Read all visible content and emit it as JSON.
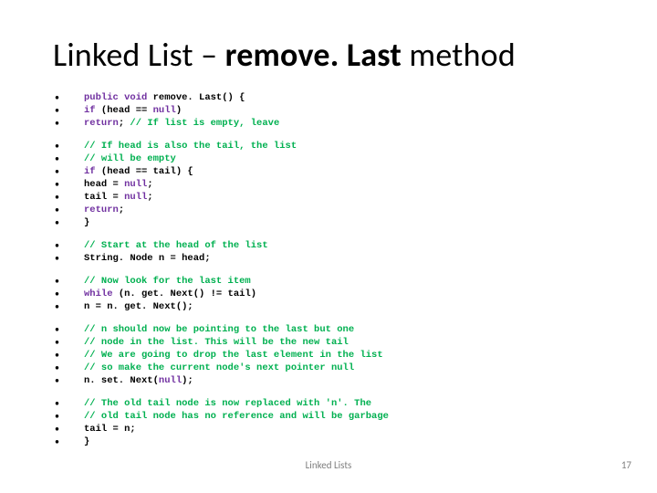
{
  "title": {
    "prefix": "Linked List – ",
    "bold": "remove. Last",
    "suffix": " method"
  },
  "blocks": [
    [
      {
        "spans": [
          {
            "t": "public void",
            "c": "kw"
          },
          {
            "t": " remove. Last() {",
            "c": "tx"
          }
        ]
      },
      {
        "spans": [
          {
            "t": "if",
            "c": "kw"
          },
          {
            "t": " (head == ",
            "c": "tx"
          },
          {
            "t": "null",
            "c": "kw"
          },
          {
            "t": ")",
            "c": "tx"
          }
        ]
      },
      {
        "spans": [
          {
            "t": "return",
            "c": "kw"
          },
          {
            "t": "; ",
            "c": "tx"
          },
          {
            "t": "// If list is empty, leave",
            "c": "cm"
          }
        ]
      }
    ],
    [
      {
        "spans": [
          {
            "t": "// If head is also the tail, the list",
            "c": "cm"
          }
        ]
      },
      {
        "spans": [
          {
            "t": "// will be empty",
            "c": "cm"
          }
        ]
      },
      {
        "spans": [
          {
            "t": "if",
            "c": "kw"
          },
          {
            "t": " (head == tail) {",
            "c": "tx"
          }
        ]
      },
      {
        "spans": [
          {
            "t": "head = ",
            "c": "tx"
          },
          {
            "t": "null",
            "c": "kw"
          },
          {
            "t": ";",
            "c": "tx"
          }
        ]
      },
      {
        "spans": [
          {
            "t": "tail = ",
            "c": "tx"
          },
          {
            "t": "null",
            "c": "kw"
          },
          {
            "t": ";",
            "c": "tx"
          }
        ]
      },
      {
        "spans": [
          {
            "t": "return",
            "c": "kw"
          },
          {
            "t": ";",
            "c": "tx"
          }
        ]
      },
      {
        "spans": [
          {
            "t": "}",
            "c": "tx"
          }
        ]
      }
    ],
    [
      {
        "spans": [
          {
            "t": "// Start at the head of the list",
            "c": "cm"
          }
        ]
      },
      {
        "spans": [
          {
            "t": "String. Node n = head;",
            "c": "tx"
          }
        ]
      }
    ],
    [
      {
        "spans": [
          {
            "t": "// Now look for the last item",
            "c": "cm"
          }
        ]
      },
      {
        "spans": [
          {
            "t": "while",
            "c": "kw"
          },
          {
            "t": " (n. get. Next() != tail)",
            "c": "tx"
          }
        ]
      },
      {
        "spans": [
          {
            "t": "n = n. get. Next();",
            "c": "tx"
          }
        ]
      }
    ],
    [
      {
        "spans": [
          {
            "t": "// n should now be pointing to the last but one",
            "c": "cm"
          }
        ]
      },
      {
        "spans": [
          {
            "t": "// node in the list. This will be the new tail",
            "c": "cm"
          }
        ]
      },
      {
        "spans": [
          {
            "t": "// We are going to drop the last element in the list",
            "c": "cm"
          }
        ]
      },
      {
        "spans": [
          {
            "t": "// so make the current node's next pointer null",
            "c": "cm"
          }
        ]
      },
      {
        "spans": [
          {
            "t": "n. set. Next(",
            "c": "tx"
          },
          {
            "t": "null",
            "c": "kw"
          },
          {
            "t": ");",
            "c": "tx"
          }
        ]
      }
    ],
    [
      {
        "spans": [
          {
            "t": "// The old tail node is now replaced with 'n'. The",
            "c": "cm"
          }
        ]
      },
      {
        "spans": [
          {
            "t": "// old tail node has no reference and will be garbage",
            "c": "cm"
          }
        ]
      },
      {
        "spans": [
          {
            "t": "tail = n;",
            "c": "tx"
          }
        ]
      },
      {
        "spans": [
          {
            "t": "}",
            "c": "tx"
          }
        ]
      }
    ]
  ],
  "footer": {
    "center": "Linked Lists",
    "right": "17"
  },
  "bullet_char": "•"
}
